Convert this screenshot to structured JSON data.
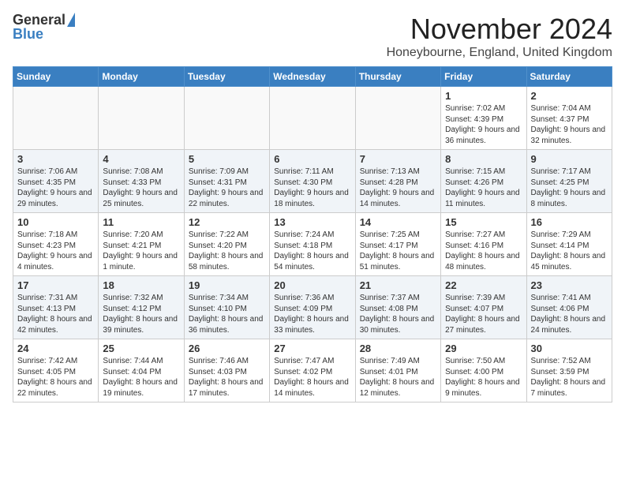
{
  "header": {
    "logo_general": "General",
    "logo_blue": "Blue",
    "month_title": "November 2024",
    "location": "Honeybourne, England, United Kingdom"
  },
  "days_of_week": [
    "Sunday",
    "Monday",
    "Tuesday",
    "Wednesday",
    "Thursday",
    "Friday",
    "Saturday"
  ],
  "weeks": [
    [
      {
        "day": "",
        "info": ""
      },
      {
        "day": "",
        "info": ""
      },
      {
        "day": "",
        "info": ""
      },
      {
        "day": "",
        "info": ""
      },
      {
        "day": "",
        "info": ""
      },
      {
        "day": "1",
        "info": "Sunrise: 7:02 AM\nSunset: 4:39 PM\nDaylight: 9 hours and 36 minutes."
      },
      {
        "day": "2",
        "info": "Sunrise: 7:04 AM\nSunset: 4:37 PM\nDaylight: 9 hours and 32 minutes."
      }
    ],
    [
      {
        "day": "3",
        "info": "Sunrise: 7:06 AM\nSunset: 4:35 PM\nDaylight: 9 hours and 29 minutes."
      },
      {
        "day": "4",
        "info": "Sunrise: 7:08 AM\nSunset: 4:33 PM\nDaylight: 9 hours and 25 minutes."
      },
      {
        "day": "5",
        "info": "Sunrise: 7:09 AM\nSunset: 4:31 PM\nDaylight: 9 hours and 22 minutes."
      },
      {
        "day": "6",
        "info": "Sunrise: 7:11 AM\nSunset: 4:30 PM\nDaylight: 9 hours and 18 minutes."
      },
      {
        "day": "7",
        "info": "Sunrise: 7:13 AM\nSunset: 4:28 PM\nDaylight: 9 hours and 14 minutes."
      },
      {
        "day": "8",
        "info": "Sunrise: 7:15 AM\nSunset: 4:26 PM\nDaylight: 9 hours and 11 minutes."
      },
      {
        "day": "9",
        "info": "Sunrise: 7:17 AM\nSunset: 4:25 PM\nDaylight: 9 hours and 8 minutes."
      }
    ],
    [
      {
        "day": "10",
        "info": "Sunrise: 7:18 AM\nSunset: 4:23 PM\nDaylight: 9 hours and 4 minutes."
      },
      {
        "day": "11",
        "info": "Sunrise: 7:20 AM\nSunset: 4:21 PM\nDaylight: 9 hours and 1 minute."
      },
      {
        "day": "12",
        "info": "Sunrise: 7:22 AM\nSunset: 4:20 PM\nDaylight: 8 hours and 58 minutes."
      },
      {
        "day": "13",
        "info": "Sunrise: 7:24 AM\nSunset: 4:18 PM\nDaylight: 8 hours and 54 minutes."
      },
      {
        "day": "14",
        "info": "Sunrise: 7:25 AM\nSunset: 4:17 PM\nDaylight: 8 hours and 51 minutes."
      },
      {
        "day": "15",
        "info": "Sunrise: 7:27 AM\nSunset: 4:16 PM\nDaylight: 8 hours and 48 minutes."
      },
      {
        "day": "16",
        "info": "Sunrise: 7:29 AM\nSunset: 4:14 PM\nDaylight: 8 hours and 45 minutes."
      }
    ],
    [
      {
        "day": "17",
        "info": "Sunrise: 7:31 AM\nSunset: 4:13 PM\nDaylight: 8 hours and 42 minutes."
      },
      {
        "day": "18",
        "info": "Sunrise: 7:32 AM\nSunset: 4:12 PM\nDaylight: 8 hours and 39 minutes."
      },
      {
        "day": "19",
        "info": "Sunrise: 7:34 AM\nSunset: 4:10 PM\nDaylight: 8 hours and 36 minutes."
      },
      {
        "day": "20",
        "info": "Sunrise: 7:36 AM\nSunset: 4:09 PM\nDaylight: 8 hours and 33 minutes."
      },
      {
        "day": "21",
        "info": "Sunrise: 7:37 AM\nSunset: 4:08 PM\nDaylight: 8 hours and 30 minutes."
      },
      {
        "day": "22",
        "info": "Sunrise: 7:39 AM\nSunset: 4:07 PM\nDaylight: 8 hours and 27 minutes."
      },
      {
        "day": "23",
        "info": "Sunrise: 7:41 AM\nSunset: 4:06 PM\nDaylight: 8 hours and 24 minutes."
      }
    ],
    [
      {
        "day": "24",
        "info": "Sunrise: 7:42 AM\nSunset: 4:05 PM\nDaylight: 8 hours and 22 minutes."
      },
      {
        "day": "25",
        "info": "Sunrise: 7:44 AM\nSunset: 4:04 PM\nDaylight: 8 hours and 19 minutes."
      },
      {
        "day": "26",
        "info": "Sunrise: 7:46 AM\nSunset: 4:03 PM\nDaylight: 8 hours and 17 minutes."
      },
      {
        "day": "27",
        "info": "Sunrise: 7:47 AM\nSunset: 4:02 PM\nDaylight: 8 hours and 14 minutes."
      },
      {
        "day": "28",
        "info": "Sunrise: 7:49 AM\nSunset: 4:01 PM\nDaylight: 8 hours and 12 minutes."
      },
      {
        "day": "29",
        "info": "Sunrise: 7:50 AM\nSunset: 4:00 PM\nDaylight: 8 hours and 9 minutes."
      },
      {
        "day": "30",
        "info": "Sunrise: 7:52 AM\nSunset: 3:59 PM\nDaylight: 8 hours and 7 minutes."
      }
    ]
  ]
}
